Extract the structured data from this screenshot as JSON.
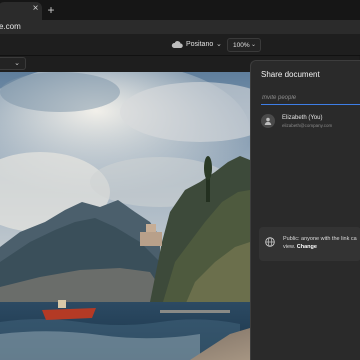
{
  "browser": {
    "tab_close": "×",
    "new_tab": "+",
    "url": "e.com"
  },
  "toolbar": {
    "doc_name": "Positano",
    "doc_chevron": "⌄",
    "zoom_value": "100%",
    "zoom_chevron": "⌄",
    "left_chevron": "⌄",
    "cloud_icon": "cloud-icon"
  },
  "share": {
    "title": "Share document",
    "invite_placeholder": "Invite people",
    "user": {
      "name": "Elizabeth (You)",
      "email": "elizabeth@company.com"
    },
    "access": {
      "line1": "Public: anyone with the link ca",
      "line2_prefix": "view. ",
      "change_label": "Change"
    }
  },
  "colors": {
    "accent": "#3e7ee6",
    "panel_bg": "#2a2a2a",
    "app_bg": "#1e1e1e"
  }
}
